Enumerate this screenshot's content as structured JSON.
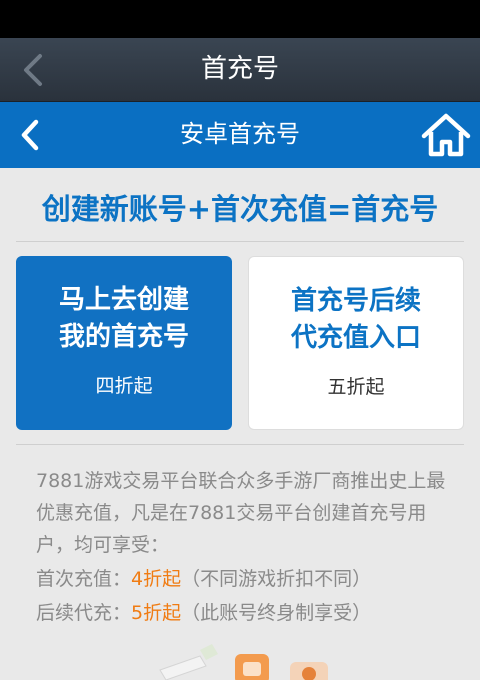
{
  "app_bar": {
    "title": "首充号"
  },
  "nav_bar": {
    "title": "安卓首充号"
  },
  "headline": "创建新账号+首次充值=首充号",
  "cards": {
    "create": {
      "label": "马上去创建\n我的首充号",
      "sub": "四折起"
    },
    "recharge": {
      "label": "首充号后续\n代充值入口",
      "sub": "五折起"
    }
  },
  "description": "7881游戏交易平台联合众多手游厂商推出史上最优惠充值，凡是在7881交易平台创建首充号用户，均可享受：",
  "first_recharge": {
    "label": "首次充值：",
    "value": "4折起",
    "note": "（不同游戏折扣不同）"
  },
  "follow_recharge": {
    "label": "后续代充：",
    "value": "5折起",
    "note": "（此账号终身制享受）"
  },
  "colors": {
    "blue": "#0a6fc2",
    "orange": "#f07c13",
    "dark_bar": "#2f3842"
  },
  "icons": {
    "back": "chevron-left-icon",
    "home": "home-icon"
  }
}
